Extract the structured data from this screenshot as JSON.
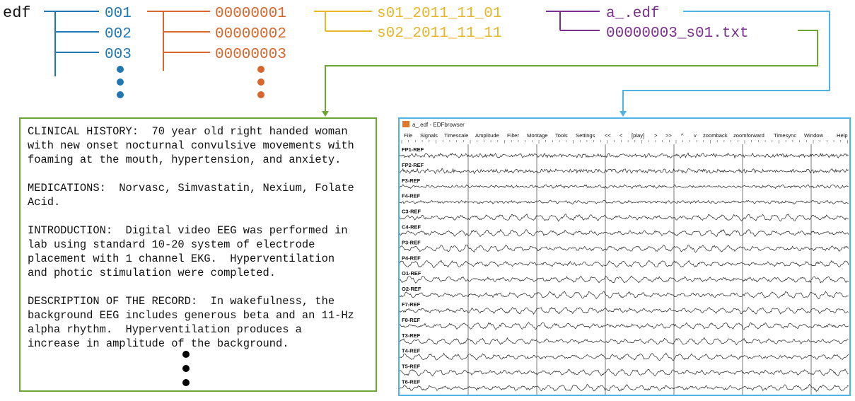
{
  "tree": {
    "root": "edf",
    "level1": [
      "001",
      "002",
      "003"
    ],
    "level2": [
      "00000001",
      "00000002",
      "00000003"
    ],
    "sessions": [
      "s01_2011_11_01",
      "s02_2011_11_11"
    ],
    "files": [
      "a_.edf",
      "00000003_s01.txt"
    ]
  },
  "colors": {
    "level1": "#1f77b4",
    "level2": "#d9662b",
    "sessions": "#e8b52b",
    "files": "#7b2f8e",
    "txt_arrow": "#6aa536",
    "edf_arrow": "#4fb3e6"
  },
  "report": {
    "text": "CLINICAL HISTORY:  70 year old right handed woman\nwith new onset nocturnal convulsive movements with\nfoaming at the mouth, hypertension, and anxiety.\n\nMEDICATIONS:  Norvasc, Simvastatin, Nexium, Folate\nAcid.\n\nINTRODUCTION:  Digital video EEG was performed in\nlab using standard 10-20 system of electrode\nplacement with 1 channel EKG.  Hyperventilation\nand photic stimulation were completed.\n\nDESCRIPTION OF THE RECORD:  In wakefulness, the\nbackground EEG includes generous beta and an 11-Hz\nalpha rhythm.  Hyperventilation produces a\nincrease in amplitude of the background."
  },
  "eeg_window": {
    "title": "a_.edf - EDFbrowser",
    "menu": [
      "File",
      "Signals",
      "Timescale",
      "Amplitude",
      "Filter",
      "Montage",
      "Tools",
      "Settings",
      "<<",
      "<",
      "[play]",
      ">",
      ">>",
      "^",
      "v",
      "zoomback",
      "zoomforward",
      "Timesync",
      "Window",
      "Help"
    ],
    "channels": [
      "FP1-REF",
      "FP2-REF",
      "F3-REF",
      "F4-REF",
      "C3-REF",
      "C4-REF",
      "P3-REF",
      "P4-REF",
      "O1-REF",
      "O2-REF",
      "F7-REF",
      "F8-REF",
      "T3-REF",
      "T4-REF",
      "T5-REF",
      "T6-REF"
    ]
  }
}
